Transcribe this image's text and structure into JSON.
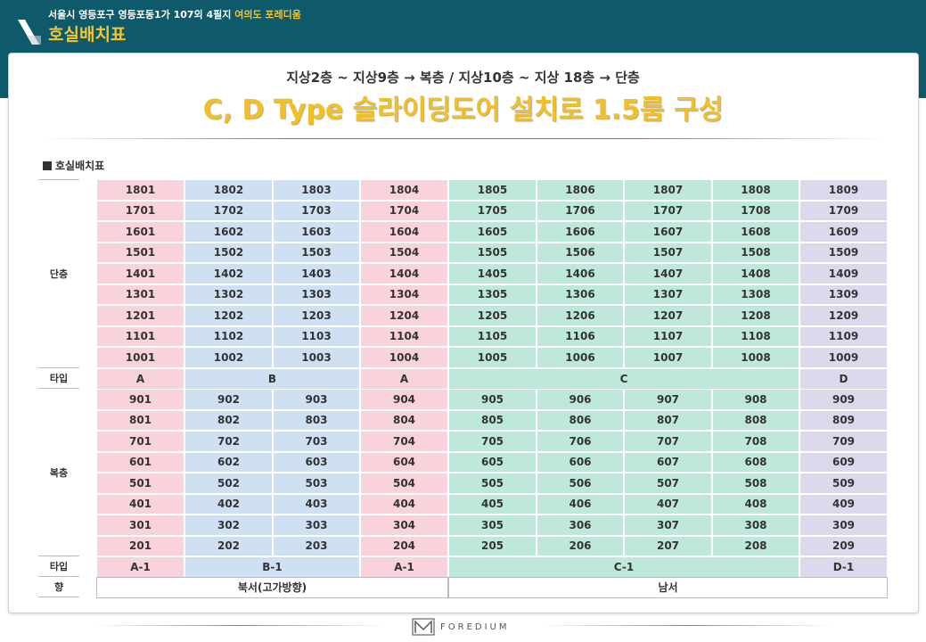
{
  "header": {
    "address": "서울시 영등포구 영등포동1가 107외 4필지",
    "project_name": "여의도 포레디움",
    "title": "호실배치표"
  },
  "subtitle": "지상2층 ~ 지상9층 → 복층 / 지상10층 ~ 지상 18층 → 단층",
  "headline": "C, D Type 슬라이딩도어 설치로 1.5룸 구성",
  "section_label": "호실배치표",
  "groups": {
    "single": "단층",
    "duplex": "복층"
  },
  "row_labels": {
    "type": "타입",
    "direction": "향"
  },
  "upper_rows": [
    [
      "1801",
      "1802",
      "1803",
      "1804",
      "1805",
      "1806",
      "1807",
      "1808",
      "1809"
    ],
    [
      "1701",
      "1702",
      "1703",
      "1704",
      "1705",
      "1706",
      "1707",
      "1708",
      "1709"
    ],
    [
      "1601",
      "1602",
      "1603",
      "1604",
      "1605",
      "1606",
      "1607",
      "1608",
      "1609"
    ],
    [
      "1501",
      "1502",
      "1503",
      "1504",
      "1505",
      "1506",
      "1507",
      "1508",
      "1509"
    ],
    [
      "1401",
      "1402",
      "1403",
      "1404",
      "1405",
      "1406",
      "1407",
      "1408",
      "1409"
    ],
    [
      "1301",
      "1302",
      "1303",
      "1304",
      "1305",
      "1306",
      "1307",
      "1308",
      "1309"
    ],
    [
      "1201",
      "1202",
      "1203",
      "1204",
      "1205",
      "1206",
      "1207",
      "1208",
      "1209"
    ],
    [
      "1101",
      "1102",
      "1103",
      "1104",
      "1105",
      "1106",
      "1107",
      "1108",
      "1109"
    ],
    [
      "1001",
      "1002",
      "1003",
      "1004",
      "1005",
      "1006",
      "1007",
      "1008",
      "1009"
    ]
  ],
  "upper_types": [
    {
      "label": "A",
      "cols": [
        0
      ]
    },
    {
      "label": "B",
      "cols": [
        1,
        2
      ]
    },
    {
      "label": "A",
      "cols": [
        3
      ]
    },
    {
      "label": "C",
      "cols": [
        4,
        5,
        6,
        7
      ]
    },
    {
      "label": "D",
      "cols": [
        8
      ]
    }
  ],
  "lower_rows": [
    [
      "901",
      "902",
      "903",
      "904",
      "905",
      "906",
      "907",
      "908",
      "909"
    ],
    [
      "801",
      "802",
      "803",
      "804",
      "805",
      "806",
      "807",
      "808",
      "809"
    ],
    [
      "701",
      "702",
      "703",
      "704",
      "705",
      "706",
      "707",
      "708",
      "709"
    ],
    [
      "601",
      "602",
      "603",
      "604",
      "605",
      "606",
      "607",
      "608",
      "609"
    ],
    [
      "501",
      "502",
      "503",
      "504",
      "505",
      "506",
      "507",
      "508",
      "509"
    ],
    [
      "401",
      "402",
      "403",
      "404",
      "405",
      "406",
      "407",
      "408",
      "409"
    ],
    [
      "301",
      "302",
      "303",
      "304",
      "305",
      "306",
      "307",
      "308",
      "309"
    ],
    [
      "201",
      "202",
      "203",
      "204",
      "205",
      "206",
      "207",
      "208",
      "209"
    ]
  ],
  "lower_types": [
    {
      "label": "A-1",
      "cols": [
        0
      ]
    },
    {
      "label": "B-1",
      "cols": [
        1,
        2
      ]
    },
    {
      "label": "A-1",
      "cols": [
        3
      ]
    },
    {
      "label": "C-1",
      "cols": [
        4,
        5,
        6,
        7
      ]
    },
    {
      "label": "D-1",
      "cols": [
        8
      ]
    }
  ],
  "directions": [
    {
      "label": "북서(고가방향)",
      "cols": [
        0,
        1,
        2,
        3
      ]
    },
    {
      "label": "남서",
      "cols": [
        4,
        5,
        6,
        7,
        8
      ]
    }
  ],
  "column_colors": [
    "#f8d3db",
    "#cfe0f2",
    "#cfe0f2",
    "#f8d3db",
    "#bfe8dd",
    "#bfe8dd",
    "#bfe8dd",
    "#bfe8dd",
    "#ddd9ec"
  ],
  "colors": {
    "header_bg": "#0f5a6a",
    "accent_yellow": "#f2c024"
  },
  "footer": {
    "brand": "FOREDIUM",
    "logo_icon": "m-logo-icon"
  }
}
